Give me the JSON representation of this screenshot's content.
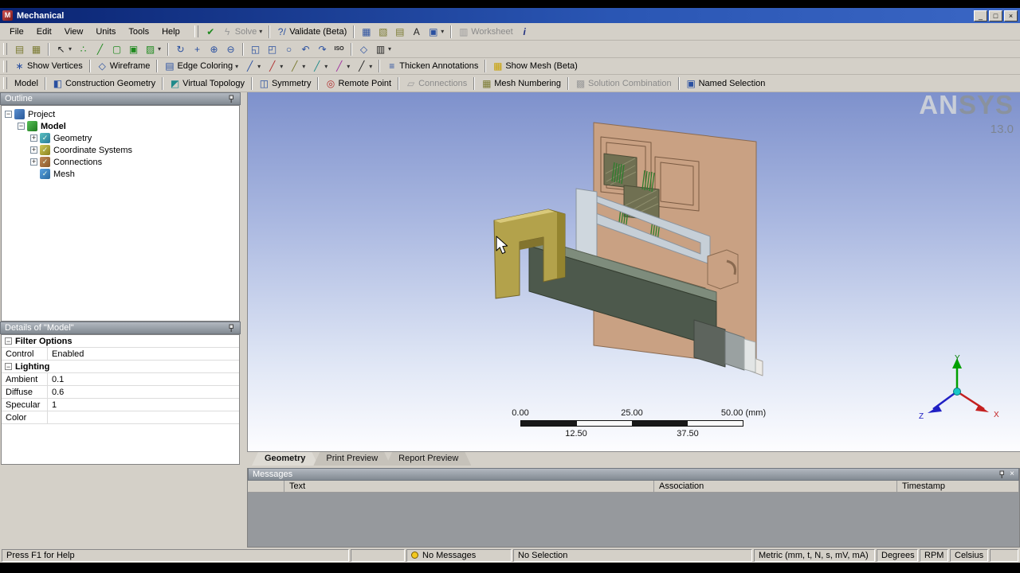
{
  "colors": {
    "chrome": "#d4d0c8",
    "titlebar": "#0a2472",
    "viewport_top": "#7e91cc",
    "viewport_bottom": "#fdfdff",
    "logo_gray": "#8a929e"
  },
  "window": {
    "title": "Mechanical",
    "app_initial": "M",
    "minimize": "_",
    "restore": "□",
    "close": "×"
  },
  "menu": {
    "items": [
      {
        "label": "File",
        "name": "menu-file"
      },
      {
        "label": "Edit",
        "name": "menu-edit"
      },
      {
        "label": "View",
        "name": "menu-view"
      },
      {
        "label": "Units",
        "name": "menu-units"
      },
      {
        "label": "Tools",
        "name": "menu-tools"
      },
      {
        "label": "Help",
        "name": "menu-help"
      }
    ]
  },
  "toolbar_top": {
    "items": [
      {
        "name": "solve-status-icon",
        "icon": "✔",
        "iconclass": "g-green"
      },
      {
        "name": "solve-button",
        "icon": "ϟ",
        "iconclass": "g-yellow",
        "label": "Solve",
        "arrow": "▾",
        "disabled": true
      },
      {
        "sep": true
      },
      {
        "name": "validate-button",
        "icon": "?/",
        "iconclass": "g-blue",
        "label": "Validate (Beta)"
      },
      {
        "sep": true
      },
      {
        "name": "new-figure-icon",
        "icon": "▦",
        "iconclass": "g-blue"
      },
      {
        "name": "new-chart-icon",
        "icon": "▧",
        "iconclass": "g-olive"
      },
      {
        "name": "new-comment-icon",
        "icon": "▤",
        "iconclass": "g-olive"
      },
      {
        "name": "annotation-icon",
        "icon": "A",
        "iconclass": "g-dark"
      },
      {
        "name": "image-capture-button",
        "icon": "▣",
        "iconclass": "g-blue",
        "arrow": "▾"
      },
      {
        "sep": true
      },
      {
        "name": "worksheet-button",
        "icon": "▥",
        "iconclass": "g-gray",
        "label": "Worksheet",
        "disabled": true
      },
      {
        "name": "info-icon",
        "icon": "i",
        "iconclass": "g-info"
      }
    ]
  },
  "toolbar_select": {
    "items": [
      {
        "name": "label-icon",
        "icon": "▤",
        "iconclass": "g-olive"
      },
      {
        "name": "comment-icon",
        "icon": "▦",
        "iconclass": "g-olive"
      },
      {
        "sep": true
      },
      {
        "name": "select-mode-button",
        "icon": "↖",
        "iconclass": "g-dark",
        "arrow": "▾"
      },
      {
        "name": "select-vertex-icon",
        "icon": "∴",
        "iconclass": "g-green"
      },
      {
        "name": "select-edge-icon",
        "icon": "╱",
        "iconclass": "g-green"
      },
      {
        "name": "select-face-icon",
        "icon": "▢",
        "iconclass": "g-green"
      },
      {
        "name": "select-body-icon",
        "icon": "▣",
        "iconclass": "g-green"
      },
      {
        "name": "extend-selection-button",
        "icon": "▨",
        "iconclass": "g-green",
        "arrow": "▾"
      },
      {
        "sep": true
      },
      {
        "name": "rotate-icon",
        "icon": "↻",
        "iconclass": "g-blue"
      },
      {
        "name": "pan-icon",
        "icon": "+",
        "iconclass": "g-blue"
      },
      {
        "name": "zoom-in-icon",
        "icon": "⊕",
        "iconclass": "g-blue"
      },
      {
        "name": "zoom-out-icon",
        "icon": "⊖",
        "iconclass": "g-blue"
      },
      {
        "sep": true
      },
      {
        "name": "box-zoom-icon",
        "icon": "◱",
        "iconclass": "g-blue"
      },
      {
        "name": "fit-icon",
        "icon": "◰",
        "iconclass": "g-blue"
      },
      {
        "name": "magnifier-icon",
        "icon": "○",
        "iconclass": "g-blue"
      },
      {
        "name": "previous-view-icon",
        "icon": "↶",
        "iconclass": "g-blue"
      },
      {
        "name": "next-view-icon",
        "icon": "↷",
        "iconclass": "g-blue"
      },
      {
        "name": "iso-view-icon",
        "icon": "ISO",
        "iconclass": "g-iso"
      },
      {
        "sep": true
      },
      {
        "name": "look-at-icon",
        "icon": "◇",
        "iconclass": "g-blue"
      },
      {
        "name": "viewports-button",
        "icon": "▥",
        "iconclass": "g-dark",
        "arrow": "▾"
      }
    ]
  },
  "toolbar_display": {
    "items": [
      {
        "name": "show-vertices-button",
        "icon": "∗",
        "iconclass": "g-blue",
        "label": "Show Vertices"
      },
      {
        "sep": true
      },
      {
        "name": "wireframe-button",
        "icon": "◇",
        "iconclass": "g-blue",
        "label": "Wireframe"
      },
      {
        "sep": true
      },
      {
        "name": "edge-coloring-button",
        "icon": "▤",
        "iconclass": "g-blue",
        "label": "Edge Coloring",
        "arrow": "▾"
      },
      {
        "name": "edge-direction-blue-button",
        "icon": "╱",
        "iconclass": "g-blue",
        "arrow": "▾"
      },
      {
        "name": "edge-direction-red-button",
        "icon": "╱",
        "iconclass": "g-red",
        "arrow": "▾"
      },
      {
        "name": "edge-direction-olive-button",
        "icon": "╱",
        "iconclass": "g-olive",
        "arrow": "▾"
      },
      {
        "name": "edge-direction-cyan-button",
        "icon": "╱",
        "iconclass": "g-cyan",
        "arrow": "▾"
      },
      {
        "name": "edge-direction-magenta-button",
        "icon": "╱",
        "iconclass": "g-magenta",
        "arrow": "▾"
      },
      {
        "name": "edge-direction-dark-button",
        "icon": "╱",
        "iconclass": "g-dark",
        "arrow": "▾"
      },
      {
        "sep": true
      },
      {
        "name": "thicken-annotations-button",
        "icon": "≡",
        "iconclass": "g-blue",
        "label": "Thicken Annotations"
      },
      {
        "sep": true
      },
      {
        "name": "show-mesh-button",
        "icon": "▦",
        "iconclass": "g-yellow",
        "label": "Show Mesh (Beta)"
      }
    ]
  },
  "context_toolbar": {
    "items": [
      {
        "name": "model-button",
        "label": "Model"
      },
      {
        "sep": true
      },
      {
        "name": "construction-geometry-button",
        "icon": "◧",
        "iconclass": "g-blue",
        "label": "Construction Geometry"
      },
      {
        "sep": true
      },
      {
        "name": "virtual-topology-button",
        "icon": "◩",
        "iconclass": "g-cyan",
        "label": "Virtual Topology"
      },
      {
        "sep": true
      },
      {
        "name": "symmetry-button",
        "icon": "◫",
        "iconclass": "g-blue",
        "label": "Symmetry"
      },
      {
        "sep": true
      },
      {
        "name": "remote-point-button",
        "icon": "◎",
        "iconclass": "g-red",
        "label": "Remote Point"
      },
      {
        "sep": true
      },
      {
        "name": "connections-button",
        "icon": "▱",
        "iconclass": "g-gray",
        "label": "Connections",
        "disabled": true
      },
      {
        "sep": true
      },
      {
        "name": "mesh-numbering-button",
        "icon": "▦",
        "iconclass": "g-olive",
        "label": "Mesh Numbering"
      },
      {
        "sep": true
      },
      {
        "name": "solution-combination-button",
        "icon": "▩",
        "iconclass": "g-gray",
        "label": "Solution Combination",
        "disabled": true
      },
      {
        "sep": true
      },
      {
        "name": "named-selection-button",
        "icon": "▣",
        "iconclass": "g-blue",
        "label": "Named Selection"
      }
    ]
  },
  "panes": {
    "outline_title": "Outline",
    "details_title": "Details of \"Model\""
  },
  "outline_tree": [
    {
      "name": "tree-item-project",
      "expander": "−",
      "icon": "",
      "iconclass": "icn-project",
      "label": "Project",
      "indent": 0
    },
    {
      "name": "tree-item-model",
      "expander": "−",
      "icon": "",
      "iconclass": "icn-model",
      "label": "Model",
      "indent": 1,
      "bold": true
    },
    {
      "name": "tree-item-geometry",
      "expander": "+",
      "icon": "✓",
      "iconclass": "icn-geometry",
      "label": "Geometry",
      "indent": 2
    },
    {
      "name": "tree-item-coordinate-systems",
      "expander": "+",
      "icon": "✓",
      "iconclass": "icn-coords",
      "label": "Coordinate Systems",
      "indent": 2
    },
    {
      "name": "tree-item-connections",
      "expander": "+",
      "icon": "✓",
      "iconclass": "icn-connections",
      "label": "Connections",
      "indent": 2
    },
    {
      "name": "tree-item-mesh",
      "expander": "",
      "icon": "✓",
      "iconclass": "icn-mesh",
      "label": "Mesh",
      "indent": 2
    }
  ],
  "details_rows": [
    {
      "cat": true,
      "exp": "−",
      "label": "Filter Options",
      "name": "details-category-filter-options"
    },
    {
      "label": "Control",
      "value": "Enabled",
      "name": "details-row-control"
    },
    {
      "cat": true,
      "exp": "−",
      "label": "Lighting",
      "name": "details-category-lighting"
    },
    {
      "label": "Ambient",
      "value": "0.1",
      "name": "details-row-ambient"
    },
    {
      "label": "Diffuse",
      "value": "0.6",
      "name": "details-row-diffuse"
    },
    {
      "label": "Specular",
      "value": "1",
      "name": "details-row-specular"
    },
    {
      "label": "Color",
      "value": "",
      "name": "details-row-color"
    }
  ],
  "viewport": {
    "logo_an": "AN",
    "logo_sys": "SYS",
    "version": "13.0",
    "ruler": {
      "top": [
        "0.00",
        "25.00",
        "50.00 (mm)"
      ],
      "bottom": [
        "12.50",
        "37.50"
      ]
    },
    "triad": {
      "x": "X",
      "y": "Y",
      "z": "Z"
    }
  },
  "tabs": [
    {
      "label": "Geometry",
      "active": true,
      "name": "tab-geometry"
    },
    {
      "label": "Print Preview",
      "name": "tab-print-preview"
    },
    {
      "label": "Report Preview",
      "name": "tab-report-preview"
    }
  ],
  "messages": {
    "title": "Messages",
    "columns": [
      "",
      "Text",
      "Association",
      "Timestamp"
    ],
    "close": "×"
  },
  "statusbar": {
    "help": "Press F1 for Help",
    "messages": "No Messages",
    "selection": "No Selection",
    "units": "Metric (mm, t, N, s, mV, mA)",
    "angle": "Degrees",
    "rotation": "RPM",
    "temperature": "Celsius"
  }
}
